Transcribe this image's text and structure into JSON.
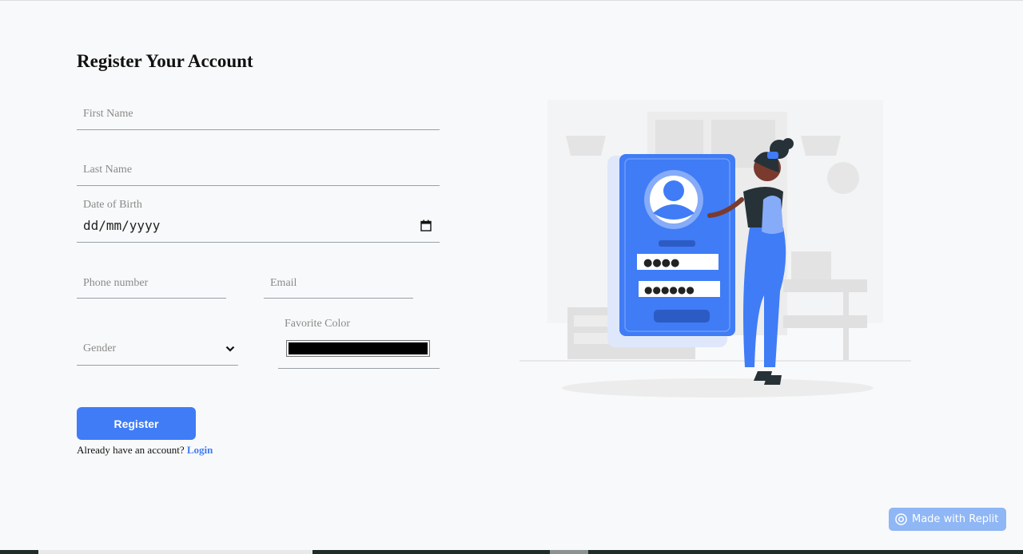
{
  "form": {
    "title": "Register Your Account",
    "first_name_placeholder": "First Name",
    "last_name_placeholder": "Last Name",
    "dob_label": "Date of Birth",
    "dob_value": "dd/mm/yyyy",
    "phone_placeholder": "Phone number",
    "email_placeholder": "Email",
    "gender_selected": "Gender",
    "favorite_color_label": "Favorite Color",
    "favorite_color_value": "#000000",
    "register_label": "Register",
    "login_prompt": "Already have an account?",
    "login_link": "Login"
  },
  "badge": {
    "label": "Made with Replit"
  },
  "colors": {
    "accent": "#3f7cf6",
    "background": "#f8f9fa",
    "badge": "#8fb6f5"
  },
  "icons": {
    "date": "calendar-icon",
    "select": "chevron-down-icon",
    "badge": "replit-logo-icon"
  }
}
